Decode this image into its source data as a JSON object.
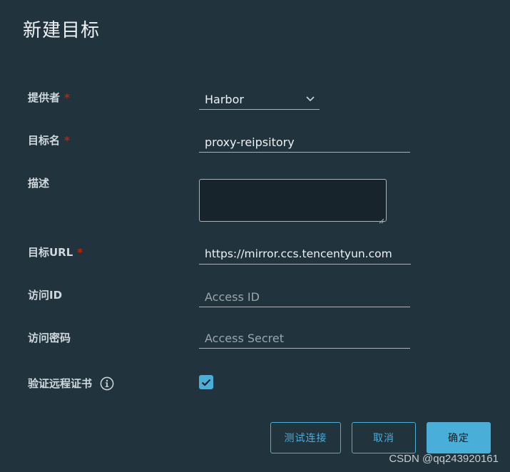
{
  "dialog": {
    "title": "新建目标"
  },
  "form": {
    "provider": {
      "label": "提供者",
      "required_mark": "*",
      "value": "Harbor"
    },
    "target_name": {
      "label": "目标名",
      "required_mark": "*",
      "value": "proxy-reipsitory"
    },
    "description": {
      "label": "描述",
      "value": ""
    },
    "target_url": {
      "label": "目标URL",
      "required_mark": "*",
      "value": "https://mirror.ccs.tencentyun.com"
    },
    "access_id": {
      "label": "访问ID",
      "value": "",
      "placeholder": "Access ID"
    },
    "access_secret": {
      "label": "访问密码",
      "value": "",
      "placeholder": "Access Secret"
    },
    "verify_cert": {
      "label": "验证远程证书",
      "checked": true
    }
  },
  "buttons": {
    "test_label": "测试连接",
    "cancel_label": "取消",
    "confirm_label": "确定"
  },
  "watermark": "CSDN @qq243920161",
  "colors": {
    "background": "#21333d",
    "accent": "#49afd9",
    "required": "#c92100"
  },
  "icons": {
    "dropdown": "chevron-down-icon",
    "info": "info-circle-icon",
    "check": "check-icon"
  }
}
